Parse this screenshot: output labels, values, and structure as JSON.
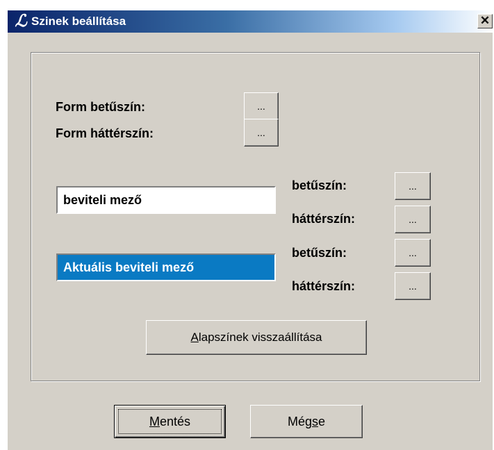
{
  "window": {
    "title": "Szinek beállítása",
    "icon": "script-l-icon",
    "close_glyph": "✕"
  },
  "form": {
    "fg_label": "Form betűszín:",
    "bg_label": "Form háttérszín:",
    "picker_label": "..."
  },
  "input_normal": {
    "text": "beviteli mező",
    "fg_label": "betűszín:",
    "bg_label": "háttérszín:"
  },
  "input_active": {
    "text": "Aktuális beviteli mező",
    "fg_label": "betűszín:",
    "bg_label": "háttérszín:",
    "background_color": "#0a7ac3",
    "text_color": "#ffffff"
  },
  "buttons": {
    "reset": {
      "mnemonic": "A",
      "rest": "lapszínek visszaállítása"
    },
    "save": {
      "mnemonic": "M",
      "rest": "entés"
    },
    "cancel": {
      "before": "Még",
      "mnemonic": "s",
      "after": "e"
    }
  },
  "colors": {
    "dialog_bg": "#d4d0c8",
    "titlebar_start": "#0a246a",
    "titlebar_end": "#a6caf0"
  }
}
